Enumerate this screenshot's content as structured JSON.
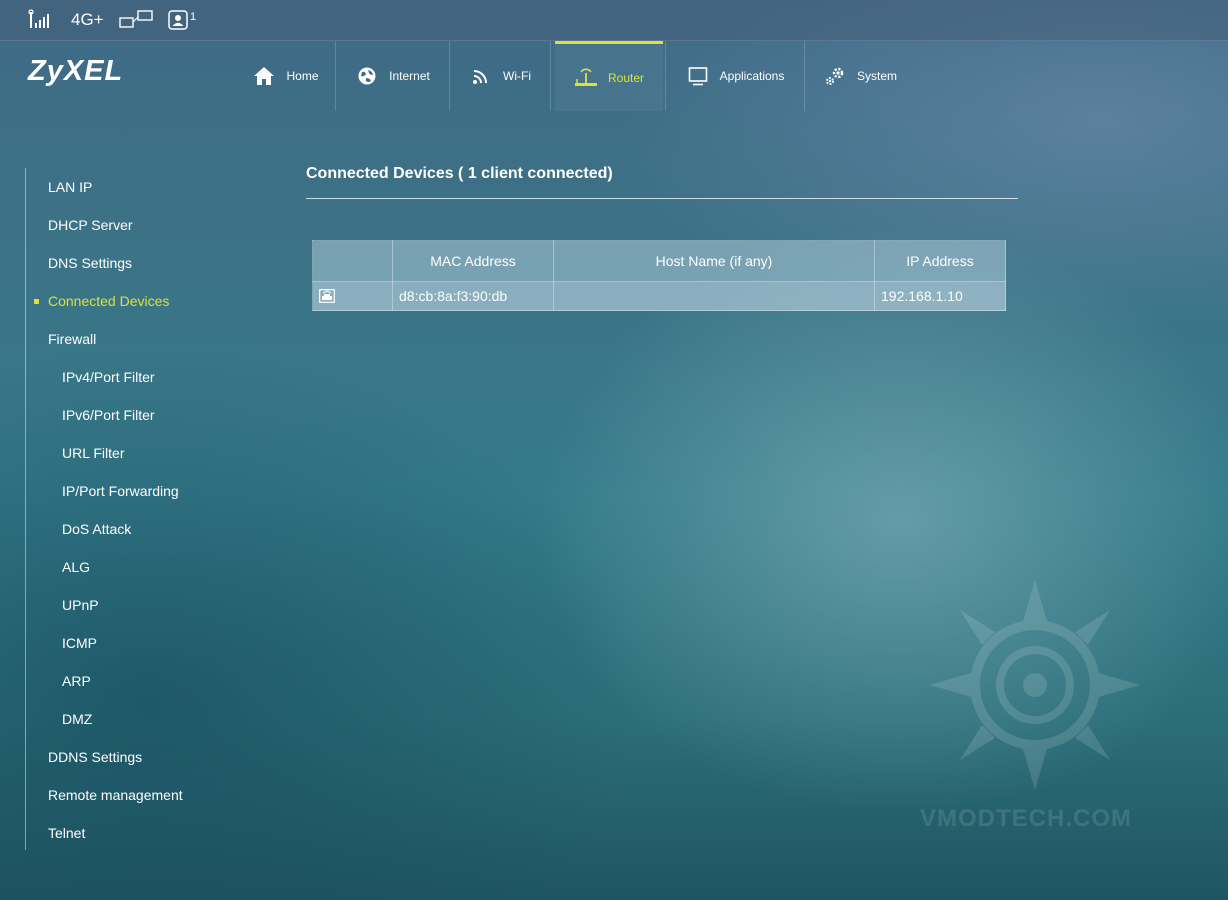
{
  "status": {
    "network": "4G+",
    "user_count": "1"
  },
  "brand": {
    "logo": "ZyXEL"
  },
  "nav": {
    "tabs": [
      {
        "label": "Home",
        "icon": "home-icon"
      },
      {
        "label": "Internet",
        "icon": "globe-icon"
      },
      {
        "label": "Wi-Fi",
        "icon": "wifi-icon"
      },
      {
        "label": "Router",
        "icon": "router-icon",
        "active": true
      },
      {
        "label": "Applications",
        "icon": "monitor-icon"
      },
      {
        "label": "System",
        "icon": "gear-icon"
      }
    ]
  },
  "sidebar": {
    "items": [
      {
        "label": "LAN IP"
      },
      {
        "label": "DHCP Server"
      },
      {
        "label": "DNS Settings"
      },
      {
        "label": "Connected Devices",
        "active": true
      },
      {
        "label": "Firewall"
      },
      {
        "label": "IPv4/Port Filter"
      },
      {
        "label": "IPv6/Port Filter"
      },
      {
        "label": "URL Filter"
      },
      {
        "label": "IP/Port Forwarding"
      },
      {
        "label": "DoS Attack"
      },
      {
        "label": "ALG"
      },
      {
        "label": "UPnP"
      },
      {
        "label": "ICMP"
      },
      {
        "label": "ARP"
      },
      {
        "label": "DMZ"
      },
      {
        "label": "DDNS Settings"
      },
      {
        "label": "Remote management"
      },
      {
        "label": "Telnet"
      }
    ]
  },
  "main": {
    "title": "Connected Devices ( 1 client connected)",
    "table": {
      "columns": [
        "",
        "MAC Address",
        "Host Name (if any)",
        "IP Address"
      ],
      "rows": [
        {
          "icon": "ethernet-device-icon",
          "mac": "d8:cb:8a:f3:90:db",
          "host": "",
          "ip": "192.168.1.10"
        }
      ]
    }
  },
  "watermark": "VMODTECH.COM",
  "colors": {
    "accent": "#dce23a"
  }
}
